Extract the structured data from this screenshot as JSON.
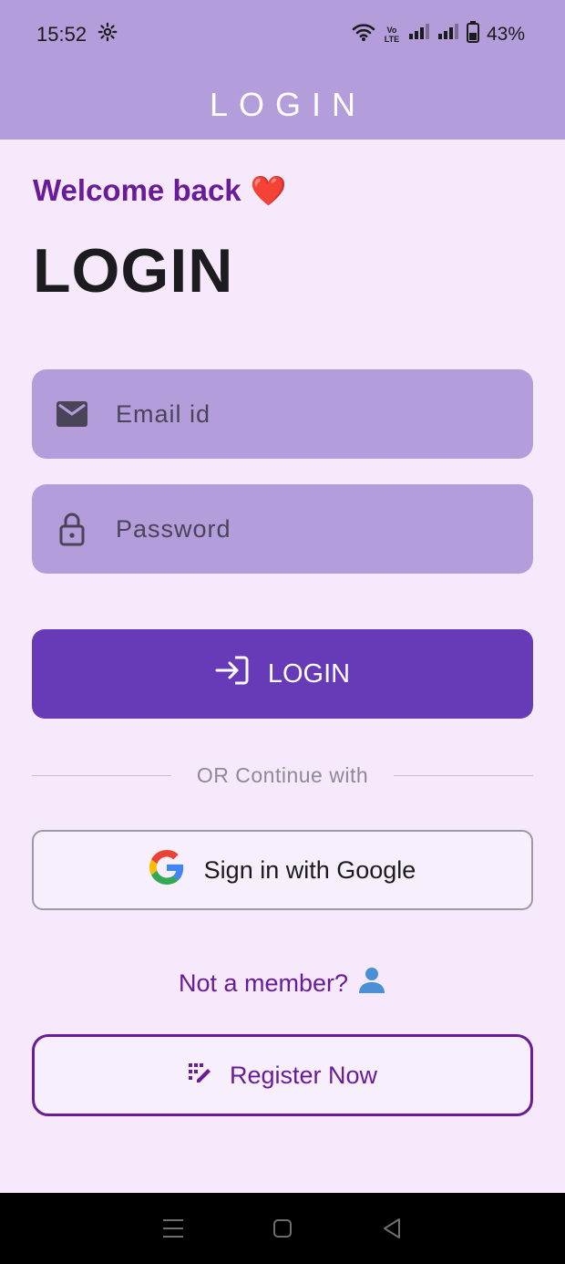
{
  "status_bar": {
    "time": "15:52",
    "network_label": "Vo LTE",
    "battery": "43%",
    "battery_level": 0.43
  },
  "app_bar": {
    "title": "LOGIN"
  },
  "welcome": {
    "text": "Welcome back",
    "emoji": "❤️"
  },
  "page_title": "LOGIN",
  "email_field": {
    "placeholder": "Email id",
    "value": ""
  },
  "password_field": {
    "placeholder": "Password",
    "value": ""
  },
  "login_button": {
    "label": "LOGIN"
  },
  "divider": {
    "text": "OR Continue with"
  },
  "google_button": {
    "label": "Sign in with Google"
  },
  "register_prompt": {
    "text": "Not a member?"
  },
  "register_button": {
    "label": "Register Now"
  },
  "icons": {
    "settings": "gear-icon",
    "wifi": "wifi-icon",
    "signal": "signal-icon",
    "battery": "battery-icon",
    "email": "mail-icon",
    "password": "lock-icon",
    "login": "login-arrow-icon",
    "google": "google-icon",
    "member": "person-icon",
    "register": "edit-note-icon",
    "nav_menu": "menu-icon",
    "nav_home": "home-square-icon",
    "nav_back": "back-triangle-icon"
  },
  "colors": {
    "primary": "#673ab7",
    "app_bar": "#b39ddb",
    "accent_text": "#6a1b9a",
    "background": "#f5e9fb"
  }
}
